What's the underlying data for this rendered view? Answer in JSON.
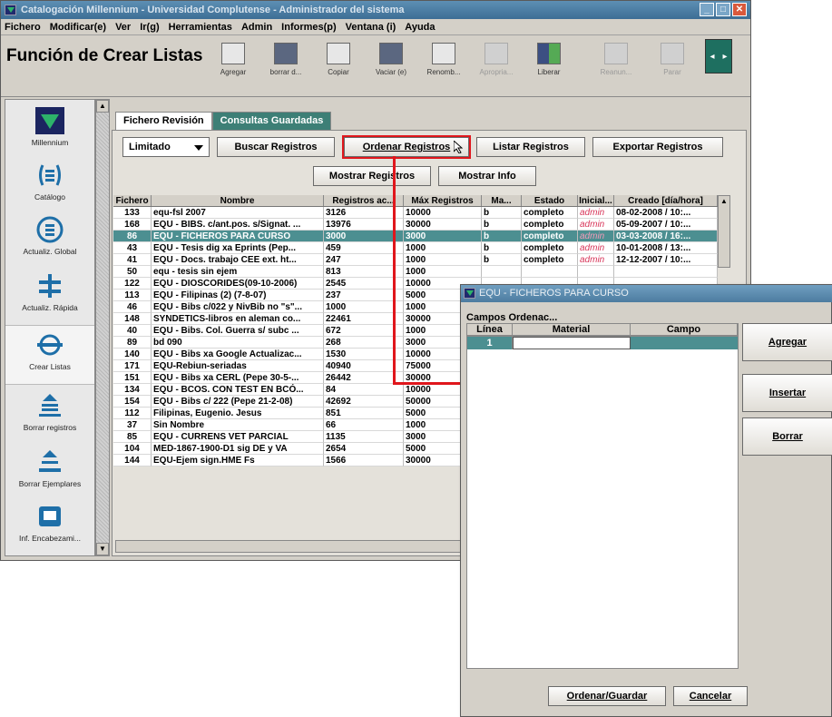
{
  "window": {
    "title": "Catalogación Millennium - Universidad Complutense - Administrador del sistema"
  },
  "menu": [
    "Fichero",
    "Modificar(e)",
    "Ver",
    "Ir(g)",
    "Herramientas",
    "Admin",
    "Informes(p)",
    "Ventana (i)",
    "Ayuda"
  ],
  "function_title": "Función de Crear Listas",
  "toolbar": {
    "buttons": [
      {
        "label": "Agregar",
        "icon": "document-add-icon",
        "enabled": true
      },
      {
        "label": "borrar d...",
        "icon": "delete-icon",
        "enabled": true
      },
      {
        "label": "Copiar",
        "icon": "copy-icon",
        "enabled": true
      },
      {
        "label": "Vaciar (e)",
        "icon": "empty-icon",
        "enabled": true
      },
      {
        "label": "Renomb...",
        "icon": "rename-icon",
        "enabled": true
      },
      {
        "label": "Apropria...",
        "icon": "appropriate-icon",
        "enabled": false
      },
      {
        "label": "Liberar",
        "icon": "release-icon",
        "enabled": true
      },
      {
        "label": "Reanun...",
        "icon": "resume-icon",
        "enabled": false
      },
      {
        "label": "Parar",
        "icon": "stop-icon",
        "enabled": false
      }
    ]
  },
  "sidebar": {
    "items": [
      {
        "label": "Millennium",
        "icon": "millennium-logo-icon"
      },
      {
        "label": "Catálogo",
        "icon": "catalog-icon"
      },
      {
        "label": "Actualiz. Global",
        "icon": "global-update-icon"
      },
      {
        "label": "Actualiz. Rápida",
        "icon": "quick-update-icon"
      },
      {
        "label": "Crear Listas",
        "icon": "create-lists-icon"
      },
      {
        "label": "Borrar registros",
        "icon": "delete-records-icon"
      },
      {
        "label": "Borrar Ejemplares",
        "icon": "delete-items-icon"
      },
      {
        "label": "Inf. Encabezami...",
        "icon": "headings-report-icon"
      }
    ]
  },
  "tabs": [
    "Fichero Revisión",
    "Consultas Guardadas"
  ],
  "actions": {
    "combo_value": "Limitado",
    "buscar": "Buscar Registros",
    "ordenar": "Ordenar Registros",
    "listar": "Listar Registros",
    "exportar": "Exportar Registros",
    "mostrar_registros": "Mostrar Registros",
    "mostrar_info": "Mostrar Info"
  },
  "table": {
    "columns": [
      "Fichero",
      "Nombre",
      "Registros ac...",
      "Máx Registros",
      "Ma...",
      "Estado",
      "Inicial...",
      "Creado [día/hora]"
    ],
    "selected_index": 2,
    "rows": [
      [
        "133",
        "equ-fsl 2007",
        "3126",
        "10000",
        "b",
        "completo",
        "admin",
        "08-02-2008 / 10:..."
      ],
      [
        "168",
        "EQU - BIBS. c/ant.pos. s/Signat. ...",
        "13976",
        "30000",
        "b",
        "completo",
        "admin",
        "05-09-2007 / 10:..."
      ],
      [
        "86",
        "EQU - FICHEROS PARA CURSO",
        "3000",
        "3000",
        "b",
        "completo",
        "admin",
        "03-03-2008 / 16:..."
      ],
      [
        "43",
        "EQU - Tesis dig xa Eprints (Pep...",
        "459",
        "1000",
        "b",
        "completo",
        "admin",
        "10-01-2008 / 13:..."
      ],
      [
        "41",
        "EQU - Docs. trabajo CEE ext. ht...",
        "247",
        "1000",
        "b",
        "completo",
        "admin",
        "12-12-2007 / 10:..."
      ],
      [
        "50",
        "equ - tesis sin ejem",
        "813",
        "1000",
        "",
        "",
        "",
        ""
      ],
      [
        "122",
        "EQU - DIOSCORIDES(09-10-2006)",
        "2545",
        "10000",
        "",
        "",
        "",
        ""
      ],
      [
        "113",
        "EQU - Filipinas (2) (7-8-07)",
        "237",
        "5000",
        "",
        "",
        "",
        ""
      ],
      [
        "46",
        "EQU - Bibs c/022 y NivBib no \"s\"...",
        "1000",
        "1000",
        "",
        "",
        "",
        ""
      ],
      [
        "148",
        "SYNDETICS-libros en aleman co...",
        "22461",
        "30000",
        "",
        "",
        "",
        ""
      ],
      [
        "40",
        "EQU - Bibs. Col. Guerra s/ subc ...",
        "672",
        "1000",
        "",
        "",
        "",
        ""
      ],
      [
        "89",
        "bd 090",
        "268",
        "3000",
        "",
        "",
        "",
        ""
      ],
      [
        "140",
        "EQU - Bibs xa Google Actualizac...",
        "1530",
        "10000",
        "",
        "",
        "",
        ""
      ],
      [
        "171",
        "EQU-Rebiun-seriadas",
        "40940",
        "75000",
        "",
        "",
        "",
        ""
      ],
      [
        "151",
        "EQU - Bibs xa CERL (Pepe 30-5-...",
        "26442",
        "30000",
        "",
        "",
        "",
        ""
      ],
      [
        "134",
        "EQU - BCOS. CON TEST EN BCÓ...",
        "84",
        "10000",
        "",
        "",
        "",
        ""
      ],
      [
        "154",
        "EQU - Bibs c/ 222 (Pepe 21-2-08)",
        "42692",
        "50000",
        "",
        "",
        "",
        ""
      ],
      [
        "112",
        "Filipinas, Eugenio. Jesus",
        "851",
        "5000",
        "",
        "",
        "",
        ""
      ],
      [
        "37",
        "Sin Nombre",
        "66",
        "1000",
        "",
        "",
        "",
        ""
      ],
      [
        "85",
        "EQU - CURRENS VET PARCIAL",
        "1135",
        "3000",
        "",
        "",
        "",
        ""
      ],
      [
        "104",
        "MED-1867-1900-D1 sig DE y VA",
        "2654",
        "5000",
        "",
        "",
        "",
        ""
      ],
      [
        "144",
        "EQU-Ejem sign.HME Fs",
        "1566",
        "30000",
        "",
        "",
        "",
        ""
      ]
    ]
  },
  "dialog": {
    "title": "EQU - FICHEROS PARA CURSO",
    "section_label": "Campos Ordenac...",
    "columns": [
      "Línea",
      "Material",
      "Campo"
    ],
    "row": {
      "linea": "1",
      "material": "",
      "campo": ""
    },
    "side_buttons": [
      "Agregar",
      "Insertar",
      "Borrar"
    ],
    "ok": "Ordenar/Guardar",
    "cancel": "Cancelar"
  },
  "colors": {
    "selection": "#4c8f91",
    "highlight": "#e0161c",
    "titlebar": "#4a7aa0",
    "admin_text": "#d8365a"
  }
}
